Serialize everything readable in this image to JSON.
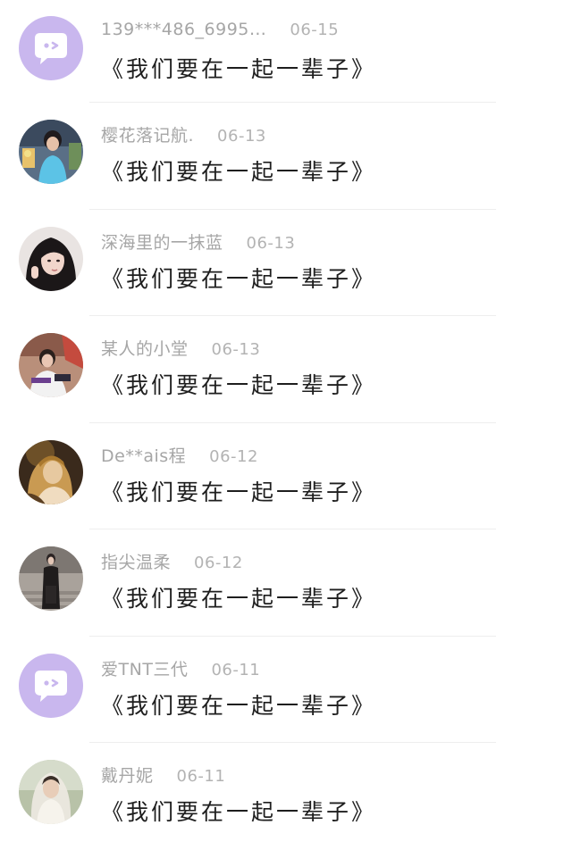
{
  "comments": [
    {
      "user": "139***486_6995…",
      "date": "06-15",
      "message": "《我们要在一起一辈子》",
      "avatar": "default-chat-avatar"
    },
    {
      "user": "樱花落记航.",
      "date": "06-13",
      "message": "《我们要在一起一辈子》",
      "avatar": "photo-avatar"
    },
    {
      "user": "深海里的一抹蓝",
      "date": "06-13",
      "message": "《我们要在一起一辈子》",
      "avatar": "photo-avatar"
    },
    {
      "user": "某人的小堂",
      "date": "06-13",
      "message": "《我们要在一起一辈子》",
      "avatar": "photo-avatar"
    },
    {
      "user": "De**ais程",
      "date": "06-12",
      "message": "《我们要在一起一辈子》",
      "avatar": "photo-avatar"
    },
    {
      "user": "指尖温柔",
      "date": "06-12",
      "message": "《我们要在一起一辈子》",
      "avatar": "photo-avatar"
    },
    {
      "user": "爱TNT三代",
      "date": "06-11",
      "message": "《我们要在一起一辈子》",
      "avatar": "default-chat-avatar"
    },
    {
      "user": "戴丹妮",
      "date": "06-11",
      "message": "《我们要在一起一辈子》",
      "avatar": "photo-avatar"
    }
  ],
  "colors": {
    "default_avatar_bg": "#c9b7ee",
    "username_text": "#a6a6a6",
    "message_text": "#1e1e1e"
  }
}
